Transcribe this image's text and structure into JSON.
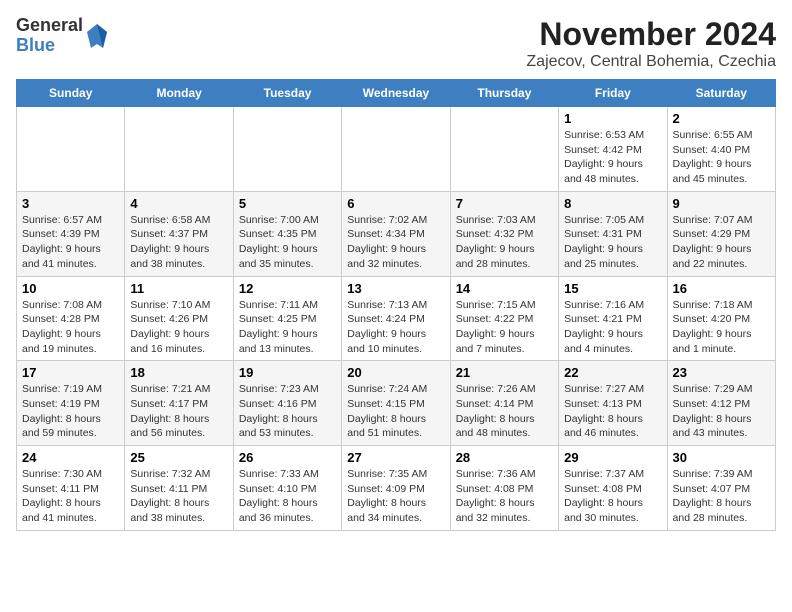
{
  "header": {
    "logo_line1": "General",
    "logo_line2": "Blue",
    "title": "November 2024",
    "subtitle": "Zajecov, Central Bohemia, Czechia"
  },
  "weekdays": [
    "Sunday",
    "Monday",
    "Tuesday",
    "Wednesday",
    "Thursday",
    "Friday",
    "Saturday"
  ],
  "weeks": [
    [
      {
        "day": "",
        "info": ""
      },
      {
        "day": "",
        "info": ""
      },
      {
        "day": "",
        "info": ""
      },
      {
        "day": "",
        "info": ""
      },
      {
        "day": "",
        "info": ""
      },
      {
        "day": "1",
        "info": "Sunrise: 6:53 AM\nSunset: 4:42 PM\nDaylight: 9 hours and 48 minutes."
      },
      {
        "day": "2",
        "info": "Sunrise: 6:55 AM\nSunset: 4:40 PM\nDaylight: 9 hours and 45 minutes."
      }
    ],
    [
      {
        "day": "3",
        "info": "Sunrise: 6:57 AM\nSunset: 4:39 PM\nDaylight: 9 hours and 41 minutes."
      },
      {
        "day": "4",
        "info": "Sunrise: 6:58 AM\nSunset: 4:37 PM\nDaylight: 9 hours and 38 minutes."
      },
      {
        "day": "5",
        "info": "Sunrise: 7:00 AM\nSunset: 4:35 PM\nDaylight: 9 hours and 35 minutes."
      },
      {
        "day": "6",
        "info": "Sunrise: 7:02 AM\nSunset: 4:34 PM\nDaylight: 9 hours and 32 minutes."
      },
      {
        "day": "7",
        "info": "Sunrise: 7:03 AM\nSunset: 4:32 PM\nDaylight: 9 hours and 28 minutes."
      },
      {
        "day": "8",
        "info": "Sunrise: 7:05 AM\nSunset: 4:31 PM\nDaylight: 9 hours and 25 minutes."
      },
      {
        "day": "9",
        "info": "Sunrise: 7:07 AM\nSunset: 4:29 PM\nDaylight: 9 hours and 22 minutes."
      }
    ],
    [
      {
        "day": "10",
        "info": "Sunrise: 7:08 AM\nSunset: 4:28 PM\nDaylight: 9 hours and 19 minutes."
      },
      {
        "day": "11",
        "info": "Sunrise: 7:10 AM\nSunset: 4:26 PM\nDaylight: 9 hours and 16 minutes."
      },
      {
        "day": "12",
        "info": "Sunrise: 7:11 AM\nSunset: 4:25 PM\nDaylight: 9 hours and 13 minutes."
      },
      {
        "day": "13",
        "info": "Sunrise: 7:13 AM\nSunset: 4:24 PM\nDaylight: 9 hours and 10 minutes."
      },
      {
        "day": "14",
        "info": "Sunrise: 7:15 AM\nSunset: 4:22 PM\nDaylight: 9 hours and 7 minutes."
      },
      {
        "day": "15",
        "info": "Sunrise: 7:16 AM\nSunset: 4:21 PM\nDaylight: 9 hours and 4 minutes."
      },
      {
        "day": "16",
        "info": "Sunrise: 7:18 AM\nSunset: 4:20 PM\nDaylight: 9 hours and 1 minute."
      }
    ],
    [
      {
        "day": "17",
        "info": "Sunrise: 7:19 AM\nSunset: 4:19 PM\nDaylight: 8 hours and 59 minutes."
      },
      {
        "day": "18",
        "info": "Sunrise: 7:21 AM\nSunset: 4:17 PM\nDaylight: 8 hours and 56 minutes."
      },
      {
        "day": "19",
        "info": "Sunrise: 7:23 AM\nSunset: 4:16 PM\nDaylight: 8 hours and 53 minutes."
      },
      {
        "day": "20",
        "info": "Sunrise: 7:24 AM\nSunset: 4:15 PM\nDaylight: 8 hours and 51 minutes."
      },
      {
        "day": "21",
        "info": "Sunrise: 7:26 AM\nSunset: 4:14 PM\nDaylight: 8 hours and 48 minutes."
      },
      {
        "day": "22",
        "info": "Sunrise: 7:27 AM\nSunset: 4:13 PM\nDaylight: 8 hours and 46 minutes."
      },
      {
        "day": "23",
        "info": "Sunrise: 7:29 AM\nSunset: 4:12 PM\nDaylight: 8 hours and 43 minutes."
      }
    ],
    [
      {
        "day": "24",
        "info": "Sunrise: 7:30 AM\nSunset: 4:11 PM\nDaylight: 8 hours and 41 minutes."
      },
      {
        "day": "25",
        "info": "Sunrise: 7:32 AM\nSunset: 4:11 PM\nDaylight: 8 hours and 38 minutes."
      },
      {
        "day": "26",
        "info": "Sunrise: 7:33 AM\nSunset: 4:10 PM\nDaylight: 8 hours and 36 minutes."
      },
      {
        "day": "27",
        "info": "Sunrise: 7:35 AM\nSunset: 4:09 PM\nDaylight: 8 hours and 34 minutes."
      },
      {
        "day": "28",
        "info": "Sunrise: 7:36 AM\nSunset: 4:08 PM\nDaylight: 8 hours and 32 minutes."
      },
      {
        "day": "29",
        "info": "Sunrise: 7:37 AM\nSunset: 4:08 PM\nDaylight: 8 hours and 30 minutes."
      },
      {
        "day": "30",
        "info": "Sunrise: 7:39 AM\nSunset: 4:07 PM\nDaylight: 8 hours and 28 minutes."
      }
    ]
  ]
}
